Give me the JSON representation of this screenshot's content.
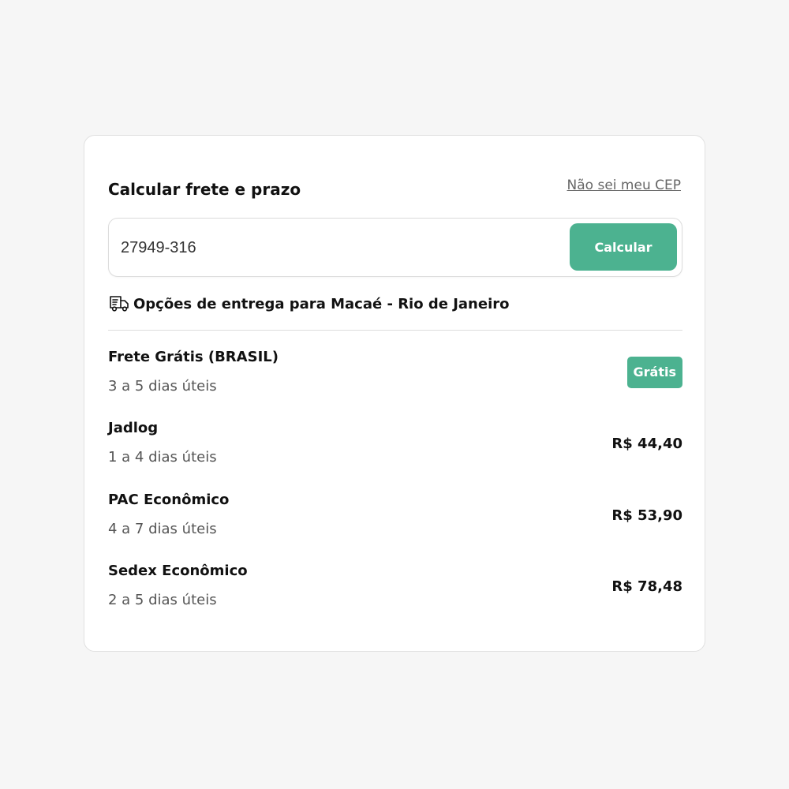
{
  "shipping": {
    "title": "Calcular frete e prazo",
    "cep_link": "Não sei meu CEP",
    "cep_value": "27949-316",
    "calc_button": "Calcular",
    "delivery_header": "Opções de entrega para Macaé - Rio de Janeiro",
    "options": [
      {
        "name": "Frete Grátis (BRASIL)",
        "days": "3 a 5 dias úteis",
        "price": "Grátis"
      },
      {
        "name": "Jadlog",
        "days": "1 a 4 dias úteis",
        "price": "R$ 44,40"
      },
      {
        "name": "PAC Econômico",
        "days": "4 a 7 dias úteis",
        "price": "R$ 53,90"
      },
      {
        "name": "Sedex Econômico",
        "days": "2 a 5 dias úteis",
        "price": "R$ 78,48"
      }
    ]
  },
  "colors": {
    "accent": "#4cb290",
    "background": "#f6f6f6",
    "card": "#ffffff"
  },
  "icons": {
    "delivery": "truck-icon"
  }
}
